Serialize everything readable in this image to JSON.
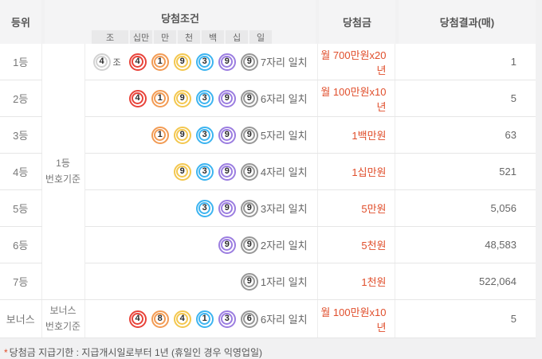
{
  "header": {
    "rank": "등위",
    "condition": "당첨조건",
    "prize": "당첨금",
    "result": "당첨결과(매)"
  },
  "digit_labels": [
    "조",
    "십만",
    "만",
    "천",
    "백",
    "십",
    "일"
  ],
  "group": {
    "main": {
      "line1": "1등",
      "line2": "번호기준"
    },
    "bonus": {
      "line1": "보너스",
      "line2": "번호기준"
    }
  },
  "ball_colors": {
    "red": "#e8433a",
    "orange": "#f29b54",
    "yellow": "#f3c74f",
    "blue": "#3cb4f0",
    "purple": "#9b7de0",
    "gray": "#979797",
    "jo": "#d2d2d2"
  },
  "accent_colors": {
    "prize_text": "#e04e2b",
    "header_bg": "#f4f4f5",
    "body_text": "#666666"
  },
  "rows": [
    {
      "rank": "1등",
      "jo": {
        "n": "4",
        "c": "jo",
        "label": "조"
      },
      "balls": [
        {
          "n": "4",
          "c": "red"
        },
        {
          "n": "1",
          "c": "orange"
        },
        {
          "n": "9",
          "c": "yellow"
        },
        {
          "n": "3",
          "c": "blue"
        },
        {
          "n": "9",
          "c": "purple"
        },
        {
          "n": "9",
          "c": "gray"
        }
      ],
      "condition": "7자리 일치",
      "prize": "월 700만원x20년",
      "count": "1"
    },
    {
      "rank": "2등",
      "balls": [
        {
          "n": "4",
          "c": "red"
        },
        {
          "n": "1",
          "c": "orange"
        },
        {
          "n": "9",
          "c": "yellow"
        },
        {
          "n": "3",
          "c": "blue"
        },
        {
          "n": "9",
          "c": "purple"
        },
        {
          "n": "9",
          "c": "gray"
        }
      ],
      "condition": "6자리 일치",
      "prize": "월 100만원x10년",
      "count": "5"
    },
    {
      "rank": "3등",
      "balls": [
        {
          "n": "1",
          "c": "orange"
        },
        {
          "n": "9",
          "c": "yellow"
        },
        {
          "n": "3",
          "c": "blue"
        },
        {
          "n": "9",
          "c": "purple"
        },
        {
          "n": "9",
          "c": "gray"
        }
      ],
      "condition": "5자리 일치",
      "prize": "1백만원",
      "count": "63"
    },
    {
      "rank": "4등",
      "balls": [
        {
          "n": "9",
          "c": "yellow"
        },
        {
          "n": "3",
          "c": "blue"
        },
        {
          "n": "9",
          "c": "purple"
        },
        {
          "n": "9",
          "c": "gray"
        }
      ],
      "condition": "4자리 일치",
      "prize": "1십만원",
      "count": "521"
    },
    {
      "rank": "5등",
      "balls": [
        {
          "n": "3",
          "c": "blue"
        },
        {
          "n": "9",
          "c": "purple"
        },
        {
          "n": "9",
          "c": "gray"
        }
      ],
      "condition": "3자리 일치",
      "prize": "5만원",
      "count": "5,056"
    },
    {
      "rank": "6등",
      "balls": [
        {
          "n": "9",
          "c": "purple"
        },
        {
          "n": "9",
          "c": "gray"
        }
      ],
      "condition": "2자리 일치",
      "prize": "5천원",
      "count": "48,583"
    },
    {
      "rank": "7등",
      "balls": [
        {
          "n": "9",
          "c": "gray"
        }
      ],
      "condition": "1자리 일치",
      "prize": "1천원",
      "count": "522,064"
    },
    {
      "rank": "보너스",
      "balls": [
        {
          "n": "4",
          "c": "red"
        },
        {
          "n": "8",
          "c": "orange"
        },
        {
          "n": "4",
          "c": "yellow"
        },
        {
          "n": "1",
          "c": "blue"
        },
        {
          "n": "3",
          "c": "purple"
        },
        {
          "n": "6",
          "c": "gray"
        }
      ],
      "condition": "6자리 일치",
      "prize": "월 100만원x10년",
      "count": "5"
    }
  ],
  "footnote": {
    "mark": "*",
    "text": "당첨금 지급기한 : 지급개시일로부터 1년 (휴일인 경우 익영업일)"
  }
}
